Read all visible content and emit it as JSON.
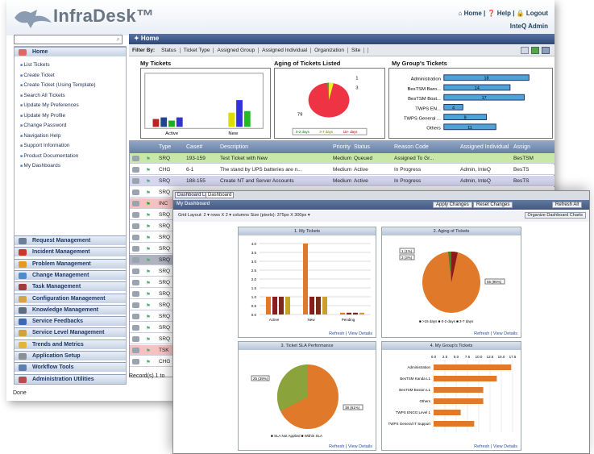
{
  "app": {
    "title": "InfraDesk™",
    "top_links": "⌂ Home | ❓ Help | 🔒 Logout",
    "user": "InteQ Admin",
    "status": "Done"
  },
  "nav": {
    "home": "✦ Home"
  },
  "filter": {
    "label": "Filter By:",
    "items": [
      "Status",
      "Ticket Type",
      "Assigned Group",
      "Assigned Individual",
      "Organization",
      "Site"
    ]
  },
  "sidebar": {
    "home": "Home",
    "links": [
      "List Tickets",
      "Create Ticket",
      "Create Ticket (Using Template)",
      "Search All Tickets",
      "Update My Preferences",
      "Update My Profile",
      "Change Password",
      "Navigation Help",
      "Support Information",
      "Product Documentation",
      "My Dashboards"
    ],
    "sections": [
      {
        "label": "Request Management",
        "color": "#6b7f9d"
      },
      {
        "label": "Incident Management",
        "color": "#c9392b"
      },
      {
        "label": "Problem Management",
        "color": "#e49a21"
      },
      {
        "label": "Change Management",
        "color": "#4a8cd1"
      },
      {
        "label": "Task Management",
        "color": "#a23c3c"
      },
      {
        "label": "Configuration Management",
        "color": "#d7a445"
      },
      {
        "label": "Knowledge Management",
        "color": "#5b6c84"
      },
      {
        "label": "Service Feedbacks",
        "color": "#3d66b6"
      },
      {
        "label": "Service Level Management",
        "color": "#d1a13e"
      },
      {
        "label": "Trends and Metrics",
        "color": "#e0b63a"
      },
      {
        "label": "Application Setup",
        "color": "#8b8f96"
      },
      {
        "label": "Workflow Tools",
        "color": "#5c7fb0"
      },
      {
        "label": "Administration Utilities",
        "color": "#b44e4e"
      }
    ]
  },
  "panels": {
    "my_tickets": "My Tickets",
    "aging": "Aging of Tickets Listed",
    "group": "My Group's Tickets"
  },
  "aging_legend": [
    "0-2 days",
    "3-7 days",
    "15+ days"
  ],
  "aging_labels": [
    "1",
    "3",
    "79"
  ],
  "my_tickets_x": [
    "Active",
    "New"
  ],
  "group_rows": [
    {
      "label": "Administration",
      "value": "18"
    },
    {
      "label": "BesTSM Baro...",
      "value": "14"
    },
    {
      "label": "BesTSM Bost...",
      "value": "17"
    },
    {
      "label": "TWPS EN...",
      "value": "4"
    },
    {
      "label": "TWPS General ...",
      "value": "9"
    },
    {
      "label": "Others",
      "value": "11"
    }
  ],
  "grid": {
    "headers": [
      "Type",
      "Case#",
      "Description",
      "Priority",
      "Status",
      "Reason Code",
      "Assigned Individual",
      "Assign"
    ],
    "rows": [
      {
        "type": "SRQ",
        "case": "193-159",
        "desc": "Test Ticket with New",
        "prio": "Medium",
        "status": "Queued",
        "reason": "Assigned To Gr...",
        "ind": "",
        "grp": "BesTSM",
        "bg": "#c9e7a8"
      },
      {
        "type": "CHG",
        "case": "6-1",
        "desc": "The stand by UPS batteries are n...",
        "prio": "Medium",
        "status": "Active",
        "reason": "In Progress",
        "ind": "Admin, InteQ",
        "grp": "BesTS",
        "bg": "#ffffff"
      },
      {
        "type": "SRQ",
        "case": "188-155",
        "desc": "Create NT and Server Accounts",
        "prio": "Medium",
        "status": "Active",
        "reason": "In Progress",
        "ind": "Admin, InteQ",
        "grp": "BesTS",
        "bg": "#d6d6ef"
      },
      {
        "type": "SRQ",
        "case": "",
        "desc": "",
        "prio": "",
        "status": "",
        "reason": "",
        "ind": "",
        "grp": "",
        "bg": "#ffffff"
      },
      {
        "type": "INC",
        "case": "",
        "desc": "",
        "prio": "",
        "status": "",
        "reason": "",
        "ind": "",
        "grp": "",
        "bg": "#f6c1c1"
      },
      {
        "type": "SRQ",
        "case": "",
        "desc": "",
        "prio": "",
        "status": "",
        "reason": "",
        "ind": "",
        "grp": "",
        "bg": "#ffffff"
      },
      {
        "type": "SRQ",
        "case": "",
        "desc": "",
        "prio": "",
        "status": "",
        "reason": "",
        "ind": "",
        "grp": "",
        "bg": "#ffffff"
      },
      {
        "type": "SRQ",
        "case": "",
        "desc": "",
        "prio": "",
        "status": "",
        "reason": "",
        "ind": "",
        "grp": "",
        "bg": "#ffffff"
      },
      {
        "type": "SRQ",
        "case": "",
        "desc": "",
        "prio": "",
        "status": "",
        "reason": "",
        "ind": "",
        "grp": "",
        "bg": "#ffffff"
      },
      {
        "type": "SRQ",
        "case": "",
        "desc": "",
        "prio": "",
        "status": "",
        "reason": "",
        "ind": "",
        "grp": "",
        "bg": "#aeb3bd"
      },
      {
        "type": "SRQ",
        "case": "",
        "desc": "",
        "prio": "",
        "status": "",
        "reason": "",
        "ind": "",
        "grp": "",
        "bg": "#ffffff"
      },
      {
        "type": "SRQ",
        "case": "",
        "desc": "",
        "prio": "",
        "status": "",
        "reason": "",
        "ind": "",
        "grp": "",
        "bg": "#ffffff"
      },
      {
        "type": "SRQ",
        "case": "",
        "desc": "",
        "prio": "",
        "status": "",
        "reason": "",
        "ind": "",
        "grp": "",
        "bg": "#ffffff"
      },
      {
        "type": "SRQ",
        "case": "",
        "desc": "",
        "prio": "",
        "status": "",
        "reason": "",
        "ind": "",
        "grp": "",
        "bg": "#ffffff"
      },
      {
        "type": "SRQ",
        "case": "",
        "desc": "",
        "prio": "",
        "status": "",
        "reason": "",
        "ind": "",
        "grp": "",
        "bg": "#ffffff"
      },
      {
        "type": "SRQ",
        "case": "",
        "desc": "",
        "prio": "",
        "status": "",
        "reason": "",
        "ind": "",
        "grp": "",
        "bg": "#ffffff"
      },
      {
        "type": "SRQ",
        "case": "",
        "desc": "",
        "prio": "",
        "status": "",
        "reason": "",
        "ind": "",
        "grp": "",
        "bg": "#ffffff"
      },
      {
        "type": "TSK",
        "case": "",
        "desc": "",
        "prio": "",
        "status": "",
        "reason": "",
        "ind": "",
        "grp": "",
        "bg": "#f6c1c1"
      },
      {
        "type": "CHG",
        "case": "",
        "desc": "",
        "prio": "",
        "status": "",
        "reason": "",
        "ind": "",
        "grp": "",
        "bg": "#ffffff"
      }
    ],
    "footer": "Record(s) 1 to"
  },
  "dash": {
    "tabs": [
      "Dashboard List",
      "Dashboard"
    ],
    "title": "My Dashboard",
    "buttons": [
      "Apply Changes",
      "Reset Changes",
      "Refresh All"
    ],
    "grid_layout": "Grid Layout:  2  ▾ rows  X  2  ▾ columns    Size (pixels):  375px X 300px  ▾",
    "organize": "Organize Dashboard Charts",
    "panels": [
      "1. My Tickets",
      "2. Aging of Tickets",
      "3. Ticket SLA Performance",
      "4. My Group's Tickets"
    ],
    "footer": "Refresh |  View Details",
    "aging_legend": "■ >15 days  ■ 0-2 days  ■ 3-7 days",
    "aging_labels": [
      "1 (1%)",
      "3 (3%)",
      "55 (96%)"
    ],
    "sla_legend": "■ SLA Not Applied  ■ Within SLA",
    "sla_labels": [
      "25 (39%)",
      "38 (61%)"
    ],
    "group_labels": [
      "Administration",
      "BesTSM Kanda L1",
      "BesTSM Boston L1",
      "Others",
      "TWPS ENGG Level 1",
      "TWPS General IT Support"
    ],
    "group_values": [
      17.2,
      14,
      11,
      11,
      6,
      9
    ],
    "group_ticks": [
      "0.0",
      "2.5",
      "5.0",
      "7.5",
      "10.0",
      "12.5",
      "15.0",
      "17.5"
    ],
    "bar_ticks": [
      "4.0",
      "3.5",
      "3.0",
      "2.5",
      "2.0",
      "1.5",
      "1.0",
      "0.5",
      "0.0"
    ],
    "bar_x": [
      "Active",
      "New",
      "Pending"
    ]
  }
}
